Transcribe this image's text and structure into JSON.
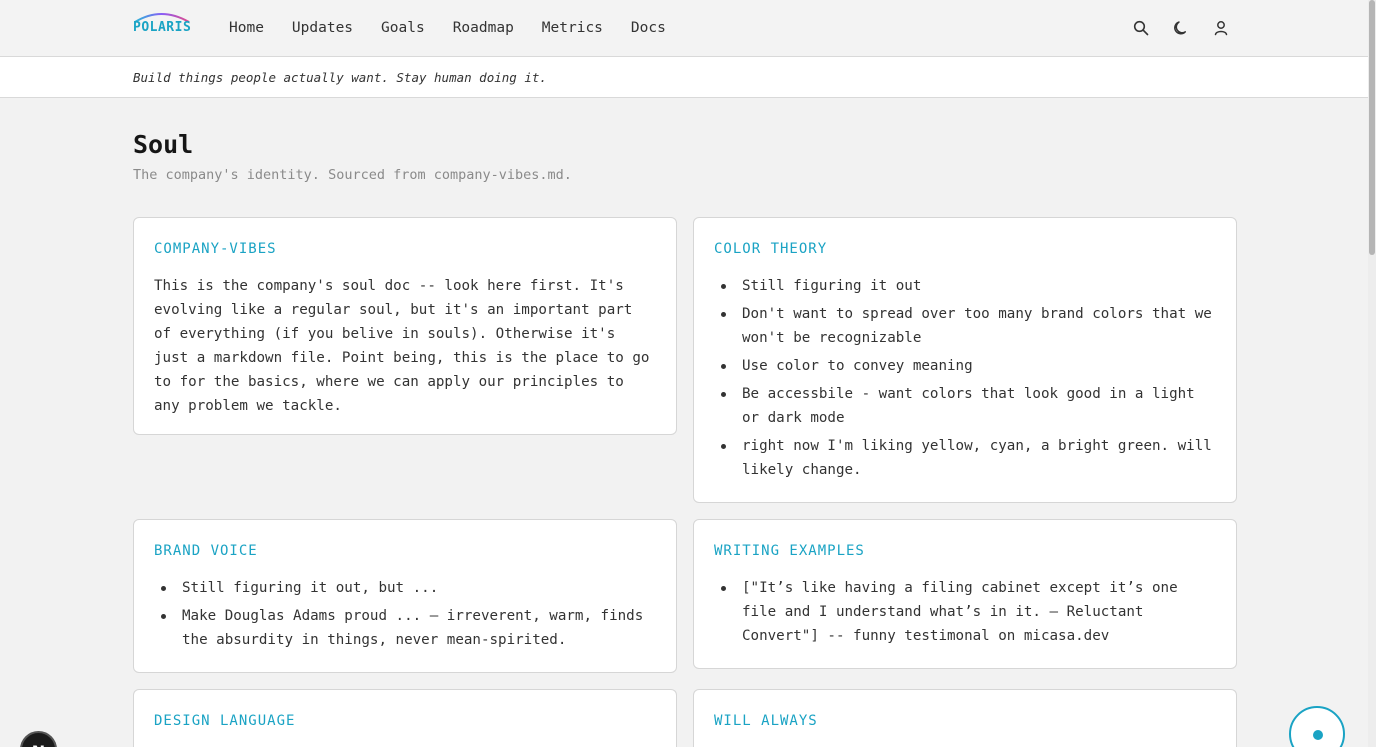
{
  "brand": {
    "name": "POLARIS"
  },
  "nav": [
    {
      "label": "Home"
    },
    {
      "label": "Updates"
    },
    {
      "label": "Goals"
    },
    {
      "label": "Roadmap"
    },
    {
      "label": "Metrics"
    },
    {
      "label": "Docs"
    }
  ],
  "icons": {
    "search": "search-icon",
    "theme": "moon-icon",
    "user": "user-icon"
  },
  "tagline": "Build things people actually want. Stay human doing it.",
  "page": {
    "title": "Soul",
    "subtitle": "The company's identity. Sourced from company-vibes.md."
  },
  "cards": {
    "company_vibes": {
      "title": "COMPANY-VIBES",
      "body": "This is the company's soul doc -- look here first. It's evolving like a regular soul, but it's an important part of everything (if you belive in souls). Otherwise it's just a markdown file. Point being, this is the place to go to for the basics, where we can apply our principles to any problem we tackle."
    },
    "color_theory": {
      "title": "COLOR THEORY",
      "items": [
        "Still figuring it out",
        "Don't want to spread over too many brand colors that we won't be recognizable",
        "Use color to convey meaning",
        "Be accessbile - want colors that look good in a light or dark mode",
        "right now I'm liking yellow, cyan, a bright green. will likely change."
      ]
    },
    "brand_voice": {
      "title": "BRAND VOICE",
      "items": [
        "Still figuring it out, but ...",
        "Make Douglas Adams proud ... — irreverent, warm, finds the absurdity in things, never mean-spirited."
      ]
    },
    "writing_examples": {
      "title": "WRITING EXAMPLES",
      "items": [
        "[\"It’s like having a filing cabinet except it’s one file and I understand what’s in it. — Reluctant Convert\"] -- funny testimonal on micasa.dev"
      ]
    },
    "design_language": {
      "title": "DESIGN LANGUAGE"
    },
    "will_always": {
      "title": "WILL ALWAYS"
    }
  },
  "badge": {
    "label": "N"
  },
  "colors": {
    "accent": "#1aa3c4",
    "background": "#f2f2f2"
  }
}
